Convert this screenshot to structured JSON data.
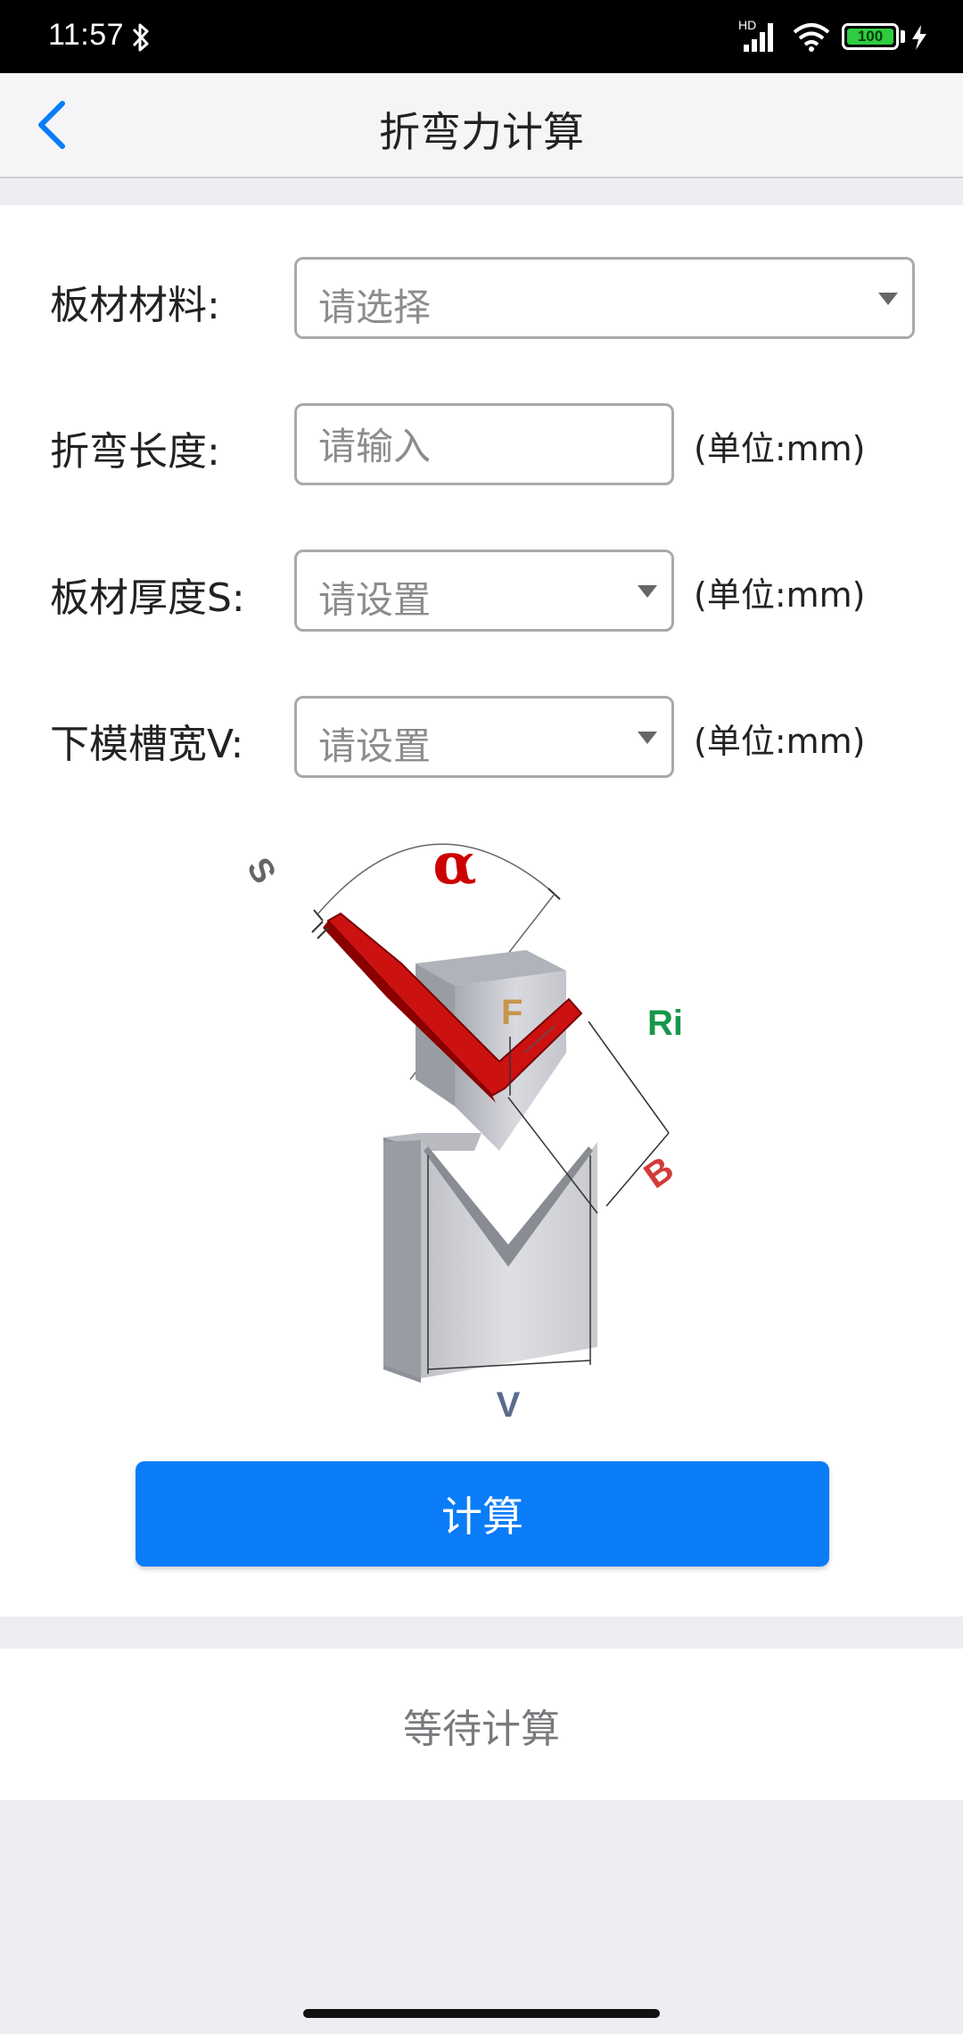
{
  "status_bar": {
    "time": "11:57",
    "network": "HD",
    "battery": "100",
    "icons": [
      "bluetooth-icon",
      "signal-icon",
      "wifi-icon",
      "battery-icon",
      "charging-icon"
    ]
  },
  "header": {
    "title": "折弯力计算",
    "back_icon": "chevron-left-icon"
  },
  "form": {
    "rows": [
      {
        "label": "板材材料:",
        "placeholder": "请选择",
        "type": "select",
        "unit": ""
      },
      {
        "label": "折弯长度:",
        "placeholder": "请输入",
        "type": "input",
        "unit": "(单位:mm)"
      },
      {
        "label": "板材厚度S:",
        "placeholder": "请设置",
        "type": "select",
        "unit": "(单位:mm)"
      },
      {
        "label": "下模槽宽V:",
        "placeholder": "请设置",
        "type": "select",
        "unit": "(单位:mm)"
      }
    ]
  },
  "diagram": {
    "labels": {
      "alpha": "α",
      "s": "S",
      "f": "F",
      "ri": "Ri",
      "b": "B",
      "v": "V"
    },
    "colors": {
      "alpha": "#cc0000",
      "ri": "#17974a",
      "f": "#c8954a",
      "b": "#d23a3a",
      "v": "#5a6b8c",
      "s": "#666666",
      "sheet": "#cc1111"
    }
  },
  "actions": {
    "calculate_label": "计算"
  },
  "result": {
    "status": "等待计算"
  },
  "colors": {
    "accent": "#0a7cf8",
    "background": "#eeeef2",
    "status_bar": "#000000"
  }
}
